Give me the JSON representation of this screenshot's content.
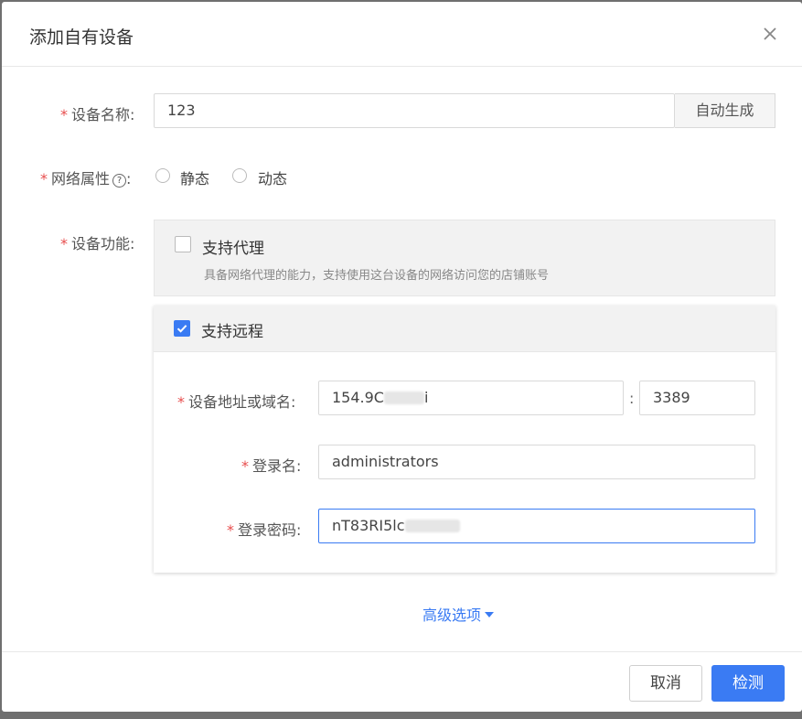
{
  "dialog": {
    "title": "添加自有设备",
    "close_icon": "close-icon"
  },
  "colors": {
    "accent": "#3a7bf3",
    "required": "#e84d4d",
    "panel_bg": "#f2f2f2"
  },
  "form": {
    "required_mark": "*",
    "device_name": {
      "label": "设备名称:",
      "value": "123",
      "addon_label": "自动生成"
    },
    "network": {
      "label": "网络属性",
      "help_icon": "question-circle-icon",
      "help_glyph": "?",
      "colon": ":",
      "options": [
        "静态",
        "动态"
      ]
    },
    "function": {
      "label": "设备功能:",
      "proxy": {
        "title": "支持代理",
        "checked": false,
        "description": "具备网络代理的能力，支持使用这台设备的网络访问您的店铺账号"
      },
      "remote": {
        "title": "支持远程",
        "checked": true,
        "address_label": "设备地址或域名:",
        "address_value": "154.9C",
        "address_tail": "i",
        "port_separator": ":",
        "port_value": "3389",
        "username_label": "登录名:",
        "username_value": "administrators",
        "password_label": "登录密码:",
        "password_value": "nT83RI5lc"
      }
    },
    "advanced_label": "高级选项"
  },
  "footer": {
    "cancel_label": "取消",
    "submit_label": "检测"
  }
}
